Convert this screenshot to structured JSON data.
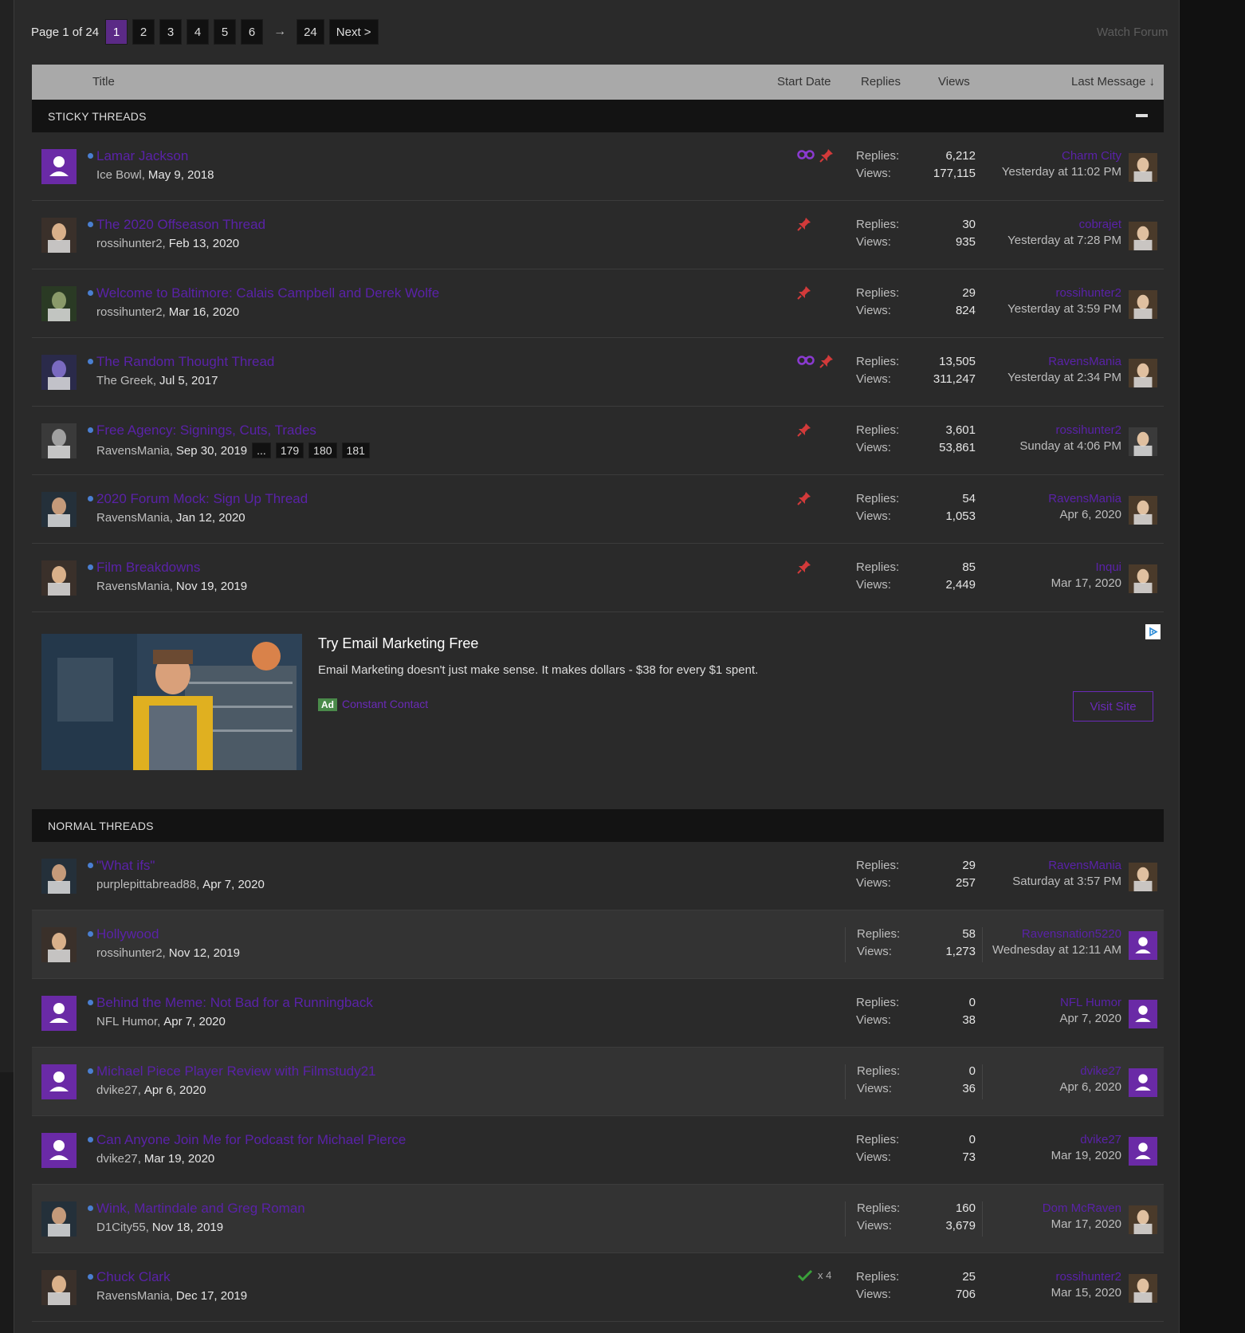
{
  "pagination": {
    "label": "Page 1 of 24",
    "pages": [
      "1",
      "2",
      "3",
      "4",
      "5",
      "6"
    ],
    "current": "1",
    "arrow": "→",
    "last": "24",
    "next": "Next >"
  },
  "watch_forum": "Watch Forum",
  "columns": {
    "title": "Title",
    "start_date": "Start Date",
    "replies": "Replies",
    "views": "Views",
    "last_message": "Last Message ↓"
  },
  "sticky_section": "STICKY THREADS",
  "normal_section": "NORMAL THREADS",
  "stat_labels": {
    "replies": "Replies:",
    "views": "Views:"
  },
  "sticky_threads": [
    {
      "title": "Lamar Jackson",
      "author": "Ice Bowl,",
      "date": "May 9, 2018",
      "replies": "6,212",
      "views": "177,115",
      "last_user": "Charm City",
      "last_time": "Yesterday at 11:02 PM",
      "watched": true,
      "sticky": true
    },
    {
      "title": "The 2020 Offseason Thread",
      "author": "rossihunter2,",
      "date": "Feb 13, 2020",
      "replies": "30",
      "views": "935",
      "last_user": "cobrajet",
      "last_time": "Yesterday at 7:28 PM",
      "watched": false,
      "sticky": true
    },
    {
      "title": "Welcome to Baltimore: Calais Campbell and Derek Wolfe",
      "author": "rossihunter2,",
      "date": "Mar 16, 2020",
      "replies": "29",
      "views": "824",
      "last_user": "rossihunter2",
      "last_time": "Yesterday at 3:59 PM",
      "watched": false,
      "sticky": true
    },
    {
      "title": "The Random Thought Thread",
      "author": "The Greek,",
      "date": "Jul 5, 2017",
      "replies": "13,505",
      "views": "311,247",
      "last_user": "RavensMania",
      "last_time": "Yesterday at 2:34 PM",
      "watched": true,
      "sticky": true
    },
    {
      "title": "Free Agency: Signings, Cuts, Trades",
      "author": "RavensMania,",
      "date": "Sep 30, 2019",
      "pages": [
        "...",
        "179",
        "180",
        "181"
      ],
      "replies": "3,601",
      "views": "53,861",
      "last_user": "rossihunter2",
      "last_time": "Sunday at 4:06 PM",
      "watched": false,
      "sticky": true
    },
    {
      "title": "2020 Forum Mock: Sign Up Thread",
      "author": "RavensMania,",
      "date": "Jan 12, 2020",
      "replies": "54",
      "views": "1,053",
      "last_user": "RavensMania",
      "last_time": "Apr 6, 2020",
      "watched": false,
      "sticky": true
    },
    {
      "title": "Film Breakdowns",
      "author": "RavensMania,",
      "date": "Nov 19, 2019",
      "replies": "85",
      "views": "2,449",
      "last_user": "Inqui",
      "last_time": "Mar 17, 2020",
      "watched": false,
      "sticky": true
    }
  ],
  "ad": {
    "title": "Try Email Marketing Free",
    "description": "Email Marketing doesn't just make sense. It makes dollars - $38 for every $1 spent.",
    "badge": "Ad",
    "brand": "Constant Contact",
    "cta": "Visit Site"
  },
  "normal_threads": [
    {
      "title": "\"What ifs\"",
      "author": "purplepittabread88,",
      "date": "Apr 7, 2020",
      "replies": "29",
      "views": "257",
      "last_user": "RavensMania",
      "last_time": "Saturday at 3:57 PM",
      "alt": false
    },
    {
      "title": "Hollywood",
      "author": "rossihunter2,",
      "date": "Nov 12, 2019",
      "replies": "58",
      "views": "1,273",
      "last_user": "Ravensnation5220",
      "last_time": "Wednesday at 12:11 AM",
      "alt": true
    },
    {
      "title": "Behind the Meme: Not Bad for a Runningback",
      "author": "NFL Humor,",
      "date": "Apr 7, 2020",
      "replies": "0",
      "views": "38",
      "last_user": "NFL Humor",
      "last_time": "Apr 7, 2020",
      "alt": false
    },
    {
      "title": "Michael Piece Player Review with Filmstudy21",
      "author": "dvike27,",
      "date": "Apr 6, 2020",
      "replies": "0",
      "views": "36",
      "last_user": "dvike27",
      "last_time": "Apr 6, 2020",
      "alt": true
    },
    {
      "title": "Can Anyone Join Me for Podcast for Michael Pierce",
      "author": "dvike27,",
      "date": "Mar 19, 2020",
      "replies": "0",
      "views": "73",
      "last_user": "dvike27",
      "last_time": "Mar 19, 2020",
      "alt": false
    },
    {
      "title": "Wink, Martindale and Greg Roman",
      "author": "D1City55,",
      "date": "Nov 18, 2019",
      "replies": "160",
      "views": "3,679",
      "last_user": "Dom McRaven",
      "last_time": "Mar 17, 2020",
      "alt": true
    },
    {
      "title": "Chuck Clark",
      "author": "RavensMania,",
      "date": "Dec 17, 2019",
      "replies": "25",
      "views": "706",
      "last_user": "rossihunter2",
      "last_time": "Mar 15, 2020",
      "likes": "x 4",
      "alt": false
    }
  ],
  "colors": {
    "accent": "#5b2a86",
    "link": "#5a22a8",
    "header_bg": "#a9a9a9",
    "section_bg": "#131313"
  }
}
